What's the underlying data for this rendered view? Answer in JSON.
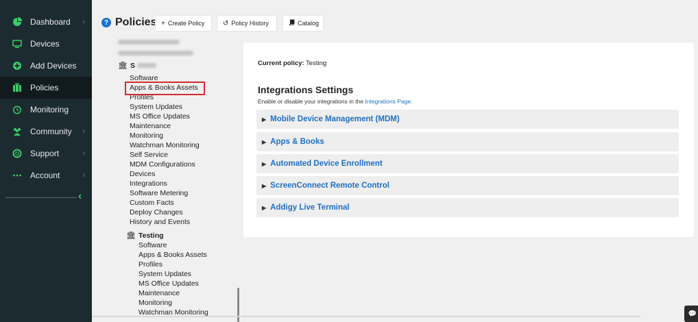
{
  "sidebar": {
    "items": [
      {
        "label": "Dashboard",
        "icon": "pie-chart-icon",
        "chevron": true
      },
      {
        "label": "Devices",
        "icon": "monitor-icon",
        "chevron": false
      },
      {
        "label": "Add Devices",
        "icon": "plus-circle-icon",
        "chevron": false
      },
      {
        "label": "Policies",
        "icon": "briefcase-icon",
        "chevron": false,
        "active": true
      },
      {
        "label": "Monitoring",
        "icon": "alarm-clock-icon",
        "chevron": false
      },
      {
        "label": "Community",
        "icon": "people-icon",
        "chevron": true
      },
      {
        "label": "Support",
        "icon": "lifebuoy-icon",
        "chevron": true
      },
      {
        "label": "Account",
        "icon": "dots-icon",
        "chevron": true
      }
    ],
    "collapse_icon": "chevron-left-icon",
    "accent_color": "#3ec96b"
  },
  "header": {
    "title": "Policies",
    "buttons": {
      "create": "Create Policy",
      "history": "Policy History",
      "catalog": "Catalog"
    }
  },
  "tree": {
    "node_s_label": "S",
    "node_s_items": [
      "Software",
      "Apps & Books Assets",
      "Profiles",
      "System Updates",
      "MS Office Updates",
      "Maintenance",
      "Monitoring",
      "Watchman Monitoring",
      "Self Service",
      "MDM Configurations",
      "Devices",
      "Integrations",
      "Software Metering",
      "Custom Facts",
      "Deploy Changes",
      "History and Events"
    ],
    "node_testing_label": "Testing",
    "node_testing_items": [
      "Software",
      "Apps & Books Assets",
      "Profiles",
      "System Updates",
      "MS Office Updates",
      "Maintenance",
      "Monitoring",
      "Watchman Monitoring"
    ]
  },
  "main": {
    "current_policy_label": "Current policy:",
    "current_policy_value": "Testing",
    "section_title": "Integrations Settings",
    "section_sub_text": "Enable or disable your integrations in the",
    "section_sub_link": "Integrations Page.",
    "accordions": [
      "Mobile Device Management (MDM)",
      "Apps & Books",
      "Automated Device Enrollment",
      "ScreenConnect Remote Control",
      "Addigy Live Terminal"
    ]
  },
  "colors": {
    "sidebar_bg": "#1c2b30",
    "link_blue": "#1f6fc4",
    "highlight_red": "#d42a2a"
  }
}
